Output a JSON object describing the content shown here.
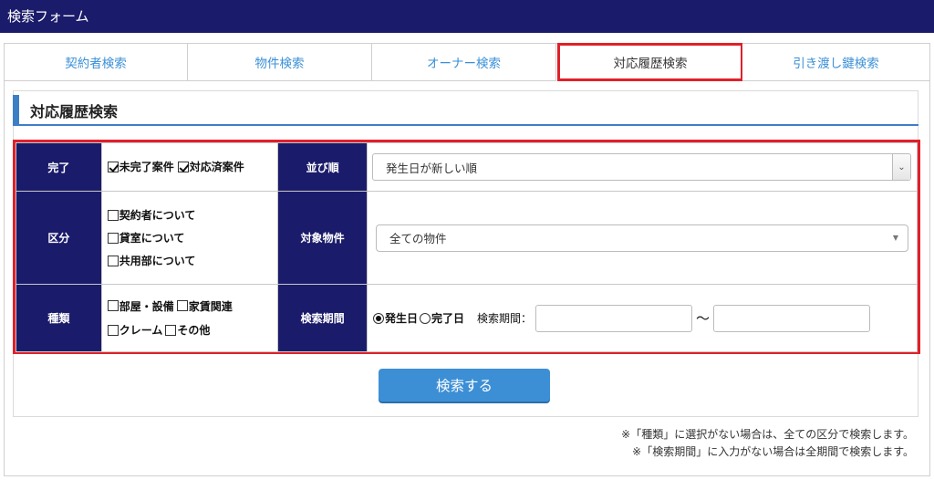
{
  "window": {
    "title": "検索フォーム"
  },
  "tabs": [
    {
      "label": "契約者検索"
    },
    {
      "label": "物件検索"
    },
    {
      "label": "オーナー検索"
    },
    {
      "label": "対応履歴検索"
    },
    {
      "label": "引き渡し鍵検索"
    }
  ],
  "active_tab": "対応履歴検索",
  "section": {
    "title": "対応履歴検索"
  },
  "form": {
    "status": {
      "label": "完了",
      "options": [
        {
          "label": "未完了案件",
          "checked": true
        },
        {
          "label": "対応済案件",
          "checked": true
        }
      ]
    },
    "sort": {
      "label": "並び順",
      "selected": "発生日が新しい順"
    },
    "category": {
      "label": "区分",
      "options": [
        {
          "label": "契約者について",
          "checked": false
        },
        {
          "label": "貸室について",
          "checked": false
        },
        {
          "label": "共用部について",
          "checked": false
        }
      ]
    },
    "property": {
      "label": "対象物件",
      "selected": "全ての物件"
    },
    "kind": {
      "label": "種類",
      "options": [
        {
          "label": "部屋・設備",
          "checked": false
        },
        {
          "label": "家賃関連",
          "checked": false
        },
        {
          "label": "クレーム",
          "checked": false
        },
        {
          "label": "その他",
          "checked": false
        }
      ]
    },
    "period": {
      "label": "検索期間",
      "radios": [
        {
          "label": "発生日",
          "selected": true
        },
        {
          "label": "完了日",
          "selected": false
        }
      ],
      "field_label": "検索期間：",
      "separator": "〜",
      "from_value": "",
      "to_value": ""
    }
  },
  "search_button": {
    "label": "検索する"
  },
  "notes": [
    "※「種類」に選択がない場合は、全ての区分で検索します。",
    "※「検索期間」に入力がない場合は全期間で検索します。"
  ],
  "colors": {
    "titlebar": "#1b1b6b",
    "label_cell": "#1b1b6b",
    "tab_text": "#3a8fd6",
    "highlight": "#e0202a",
    "button": "#3d8fd5",
    "section_accent": "#3d7fc6"
  }
}
